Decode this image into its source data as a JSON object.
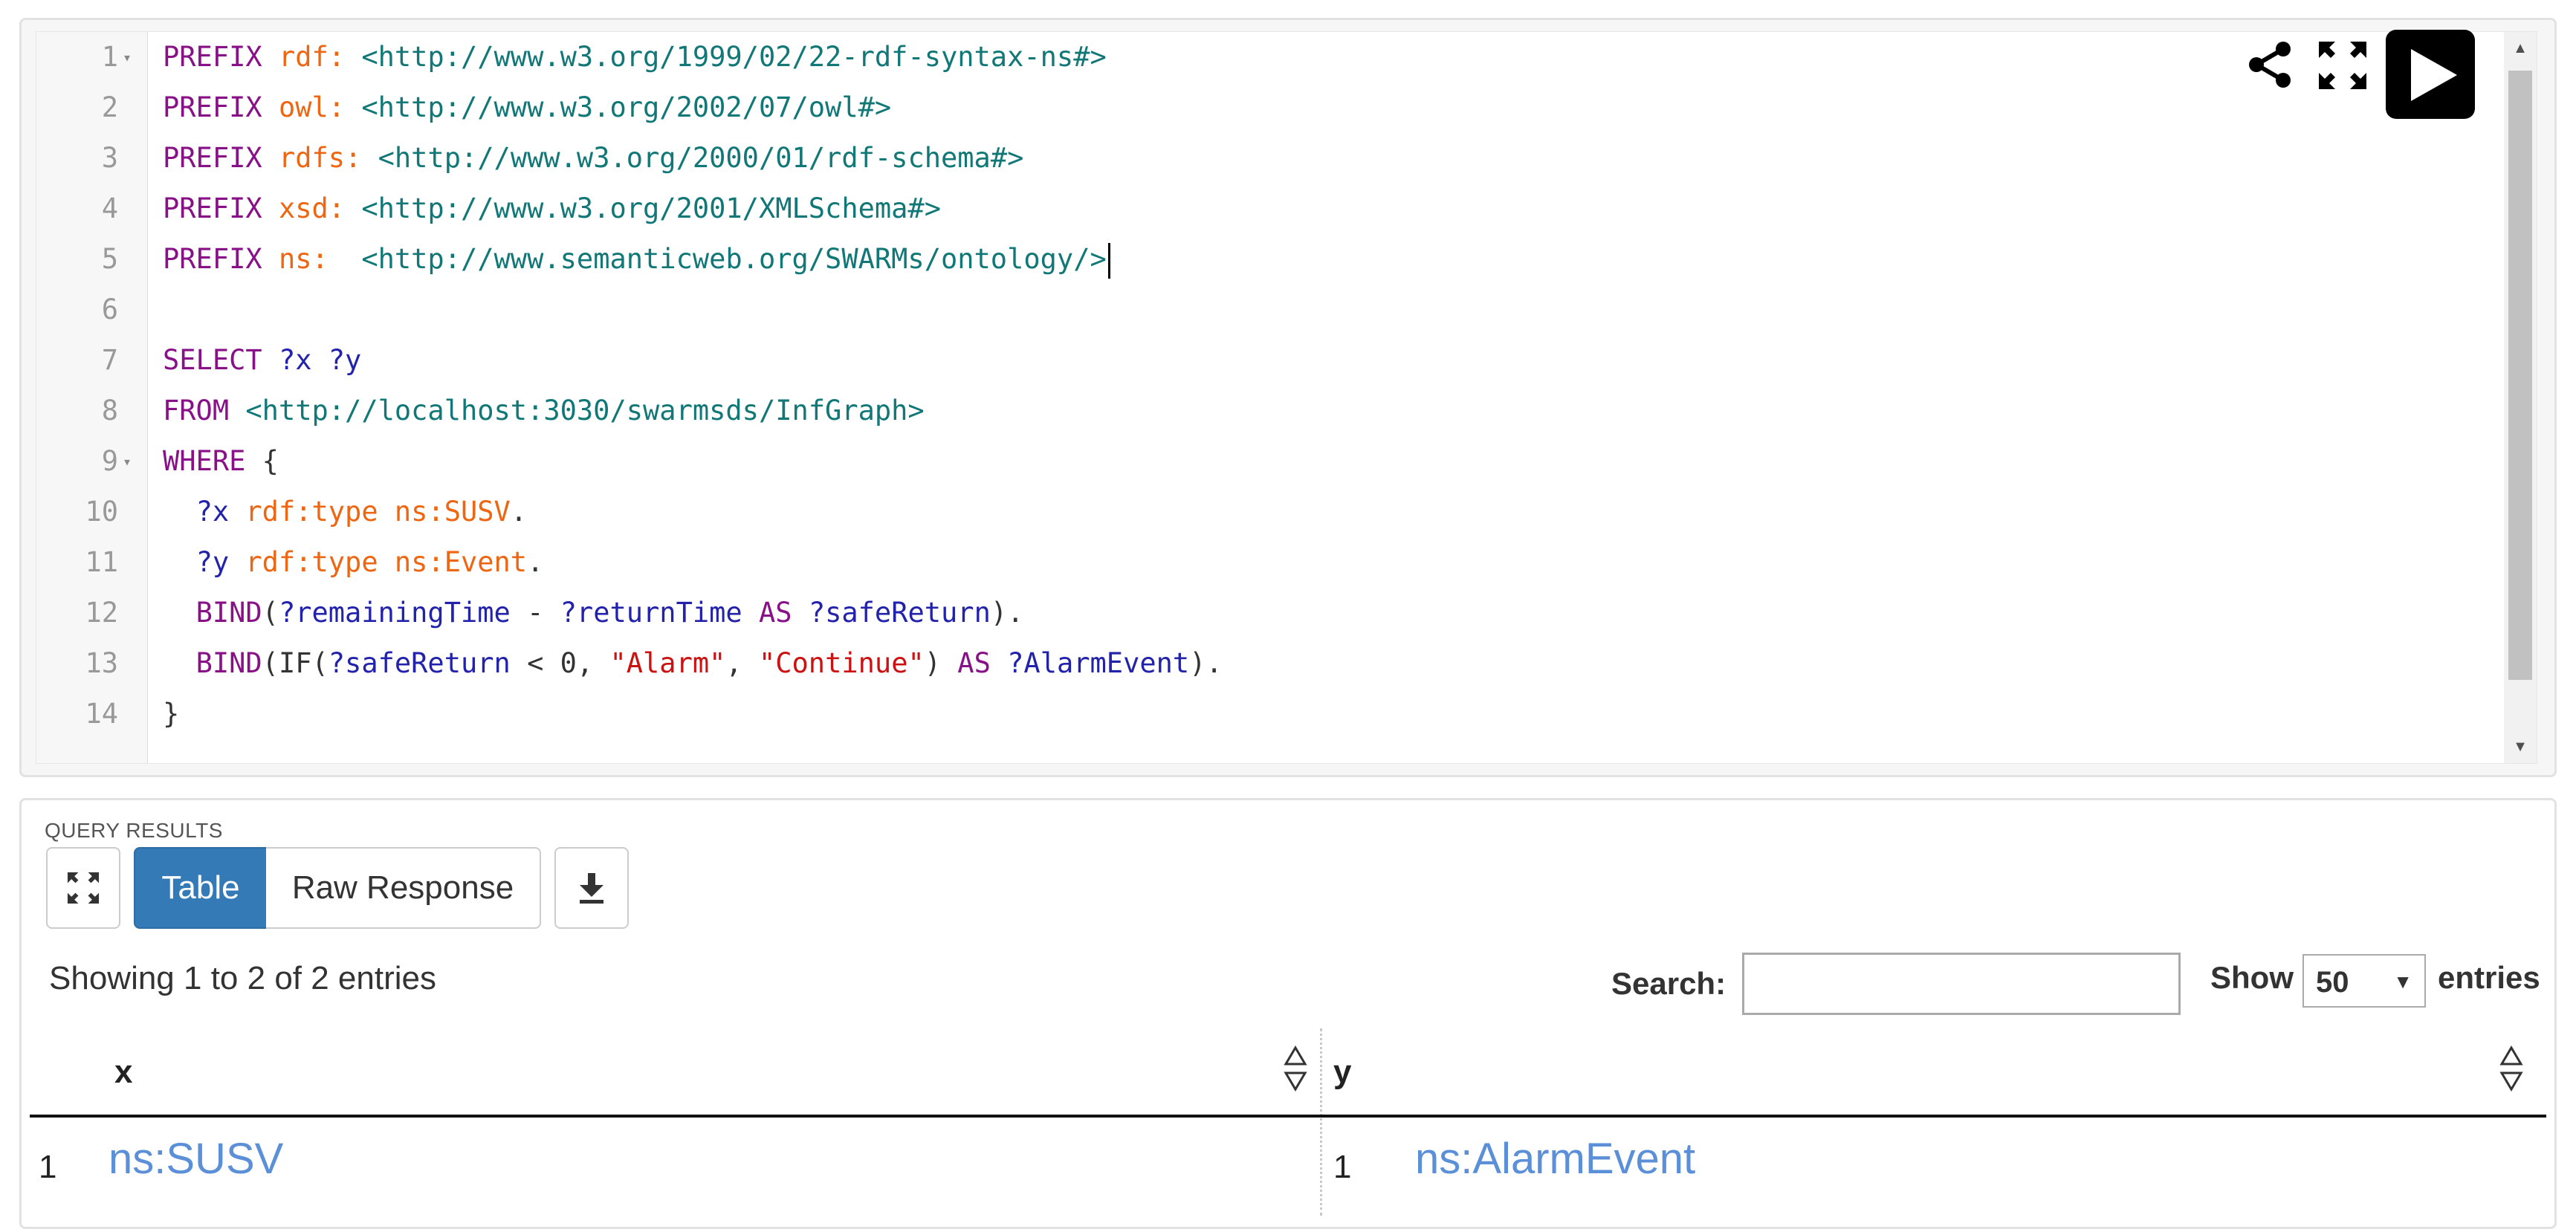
{
  "editor": {
    "lines": [
      {
        "num": "1",
        "fold": "▾",
        "segments": [
          {
            "t": "PREFIX ",
            "c": "kw"
          },
          {
            "t": "rdf:",
            "c": "pfx"
          },
          {
            "t": " ",
            "c": ""
          },
          {
            "t": "<http://www.w3.org/1999/02/22-rdf-syntax-ns#>",
            "c": "uri"
          }
        ]
      },
      {
        "num": "2",
        "fold": "",
        "segments": [
          {
            "t": "PREFIX ",
            "c": "kw"
          },
          {
            "t": "owl:",
            "c": "pfx"
          },
          {
            "t": " ",
            "c": ""
          },
          {
            "t": "<http://www.w3.org/2002/07/owl#>",
            "c": "uri"
          }
        ]
      },
      {
        "num": "3",
        "fold": "",
        "segments": [
          {
            "t": "PREFIX ",
            "c": "kw"
          },
          {
            "t": "rdfs:",
            "c": "pfx"
          },
          {
            "t": " ",
            "c": ""
          },
          {
            "t": "<http://www.w3.org/2000/01/rdf-schema#>",
            "c": "uri"
          }
        ]
      },
      {
        "num": "4",
        "fold": "",
        "segments": [
          {
            "t": "PREFIX ",
            "c": "kw"
          },
          {
            "t": "xsd:",
            "c": "pfx"
          },
          {
            "t": " ",
            "c": ""
          },
          {
            "t": "<http://www.w3.org/2001/XMLSchema#>",
            "c": "uri"
          }
        ]
      },
      {
        "num": "5",
        "fold": "",
        "cursor": true,
        "segments": [
          {
            "t": "PREFIX ",
            "c": "kw"
          },
          {
            "t": "ns:",
            "c": "pfx"
          },
          {
            "t": "  ",
            "c": ""
          },
          {
            "t": "<http://www.semanticweb.org/SWARMs/ontology/>",
            "c": "uri"
          }
        ]
      },
      {
        "num": "6",
        "fold": "",
        "segments": []
      },
      {
        "num": "7",
        "fold": "",
        "segments": [
          {
            "t": "SELECT ",
            "c": "kw"
          },
          {
            "t": "?x ?y",
            "c": "var"
          }
        ]
      },
      {
        "num": "8",
        "fold": "",
        "segments": [
          {
            "t": "FROM ",
            "c": "kw"
          },
          {
            "t": "<http://localhost:3030/swarmsds/InfGraph>",
            "c": "uri"
          }
        ]
      },
      {
        "num": "9",
        "fold": "▾",
        "segments": [
          {
            "t": "WHERE ",
            "c": "kw"
          },
          {
            "t": "{",
            "c": ""
          }
        ]
      },
      {
        "num": "10",
        "fold": "",
        "segments": [
          {
            "t": "  ",
            "c": ""
          },
          {
            "t": "?x ",
            "c": "var"
          },
          {
            "t": "rdf:type ns:SUSV",
            "c": "pfx"
          },
          {
            "t": ".",
            "c": ""
          }
        ]
      },
      {
        "num": "11",
        "fold": "",
        "segments": [
          {
            "t": "  ",
            "c": ""
          },
          {
            "t": "?y ",
            "c": "var"
          },
          {
            "t": "rdf:type ns:Event",
            "c": "pfx"
          },
          {
            "t": ".",
            "c": ""
          }
        ]
      },
      {
        "num": "12",
        "fold": "",
        "segments": [
          {
            "t": "  ",
            "c": ""
          },
          {
            "t": "BIND",
            "c": "kw"
          },
          {
            "t": "(",
            "c": ""
          },
          {
            "t": "?remainingTime",
            "c": "var"
          },
          {
            "t": " - ",
            "c": ""
          },
          {
            "t": "?returnTime",
            "c": "var"
          },
          {
            "t": " AS ",
            "c": "kw"
          },
          {
            "t": "?safeReturn",
            "c": "var"
          },
          {
            "t": ").",
            "c": ""
          }
        ]
      },
      {
        "num": "13",
        "fold": "",
        "segments": [
          {
            "t": "  ",
            "c": ""
          },
          {
            "t": "BIND",
            "c": "kw"
          },
          {
            "t": "(IF(",
            "c": ""
          },
          {
            "t": "?safeReturn",
            "c": "var"
          },
          {
            "t": " < 0, ",
            "c": ""
          },
          {
            "t": "\"Alarm\"",
            "c": "str"
          },
          {
            "t": ", ",
            "c": ""
          },
          {
            "t": "\"Continue\"",
            "c": "str"
          },
          {
            "t": ")",
            "c": ""
          },
          {
            "t": " AS ",
            "c": "kw"
          },
          {
            "t": "?AlarmEvent",
            "c": "var"
          },
          {
            "t": ").",
            "c": ""
          }
        ]
      },
      {
        "num": "14",
        "fold": "",
        "segments": [
          {
            "t": "}",
            "c": ""
          }
        ]
      }
    ],
    "icons": {
      "share": "share-icon",
      "fullscreen": "fullscreen-icon",
      "run": "play-icon"
    },
    "scroll_up": "▲",
    "scroll_down": "▼"
  },
  "results": {
    "title": "QUERY RESULTS",
    "tabs": {
      "table": "Table",
      "raw": "Raw Response"
    },
    "info": "Showing 1 to 2 of 2 entries",
    "search_label": "Search:",
    "search_value": "",
    "show_label": "Show",
    "page_size": "50",
    "entries_label": "entries",
    "columns": [
      "x",
      "y"
    ],
    "rows": [
      {
        "x_num": "1",
        "x_val": "ns:SUSV",
        "y_num": "1",
        "y_val": "ns:AlarmEvent"
      }
    ]
  },
  "colors": {
    "keyword": "#881188",
    "prefix": "#ee6611",
    "uri": "#117777",
    "variable": "#2222aa",
    "string": "#cc1111",
    "table_active": "#337ab7",
    "link": "#5b8fd8"
  }
}
